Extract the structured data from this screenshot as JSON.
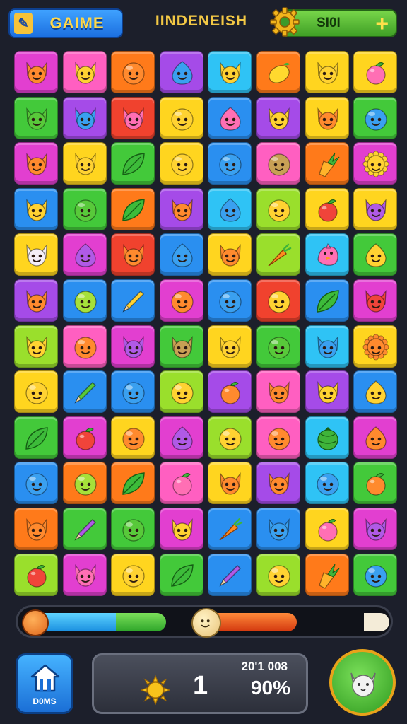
{
  "header": {
    "game_button_label": "GAIME",
    "title": "IINDENEISH",
    "slot_label": "SI0I",
    "plus_label": "+"
  },
  "board": {
    "columns": 8,
    "rows": 12,
    "tiles": [
      [
        "magenta:cat-orange",
        "pink:cat-yellow",
        "orange:ball-orange",
        "purple:blob-blue",
        "cyan:cat-yellow",
        "orange:lemon",
        "yellow:cat-yellow",
        "yellow:apple-pink"
      ],
      [
        "green:cat-green",
        "purple:cat-blue",
        "red:cat-pink",
        "yellow:ball-yellow",
        "blue:blob-pink",
        "purple:cat-yellow",
        "yellow:cat-orange",
        "green:ball-blue"
      ],
      [
        "magenta:cat-orange",
        "yellow:cat-yellow",
        "green:leaf",
        "yellow:ball-yellow",
        "blue:ball-blue",
        "pink:ball-tan",
        "orange:pineapple",
        "magenta:sun-yellow"
      ],
      [
        "blue:cat-yellow",
        "green:ball-green",
        "orange:leaf",
        "purple:cat-orange",
        "cyan:blob-blue",
        "lime:ball-yellow",
        "yellow:apple-red",
        "yellow:cat-purple"
      ],
      [
        "yellow:cat-white",
        "magenta:blob-purple",
        "red:cat-orange",
        "blue:blob-blue",
        "yellow:cat-orange",
        "lime:carrot",
        "cyan:bird-pink",
        "green:blob-yellow"
      ],
      [
        "purple:cat-orange",
        "blue:ball-lime",
        "blue:pencil",
        "magenta:ball-orange",
        "blue:ball-blue",
        "red:ball-yellow",
        "blue:leaf",
        "magenta:cat-red"
      ],
      [
        "lime:cat-yellow",
        "pink:ball-orange",
        "magenta:cat-purple",
        "green:cat-tan",
        "yellow:cat-yellow",
        "green:ball-green",
        "cyan:cat-blue",
        "yellow:sun-orange"
      ],
      [
        "yellow:ball-yellow",
        "blue:pencil-green",
        "blue:ball-blue",
        "lime:ball-yellow",
        "purple:apple-orange",
        "pink:cat-orange",
        "purple:cat-yellow",
        "blue:blob-yellow"
      ],
      [
        "green:leaf",
        "magenta:apple-red",
        "yellow:ball-orange",
        "magenta:blob-purple",
        "lime:ball-yellow",
        "pink:ball-orange",
        "cyan:melon",
        "magenta:blob-orange"
      ],
      [
        "blue:ball-blue",
        "orange:ball-lime",
        "orange:leaf",
        "pink:apple-pink",
        "yellow:cat-orange",
        "purple:cat-orange",
        "cyan:ball-blue",
        "green:apple-orange"
      ],
      [
        "orange:cat-orange",
        "green:pencil-purple",
        "green:ball-green",
        "magenta:cat-yellow",
        "blue:carrot",
        "blue:cat-blue",
        "yellow:apple-pink",
        "magenta:cat-purple"
      ],
      [
        "lime:apple-red",
        "magenta:cat-pink",
        "yellow:ball-yellow",
        "green:leaf",
        "blue:pencil-purple",
        "lime:ball-yellow",
        "orange:pineapple",
        "green:ball-blue"
      ]
    ]
  },
  "progress": {
    "blue_segment": 0.27,
    "green_segment": 0.14,
    "orange_segment": 0.25
  },
  "footer": {
    "home_label": "D0MS",
    "level": "1",
    "score": "20'1 008",
    "percent": "90%"
  },
  "colors": {
    "magenta": "#e23fd0",
    "pink": "#ff5fc1",
    "orange": "#ff7a1a",
    "purple": "#a54be8",
    "cyan": "#2fc3f5",
    "yellow": "#ffd51f",
    "green": "#43c93a",
    "red": "#f0422e",
    "blue": "#2a8ff0",
    "lime": "#9adf2c"
  }
}
